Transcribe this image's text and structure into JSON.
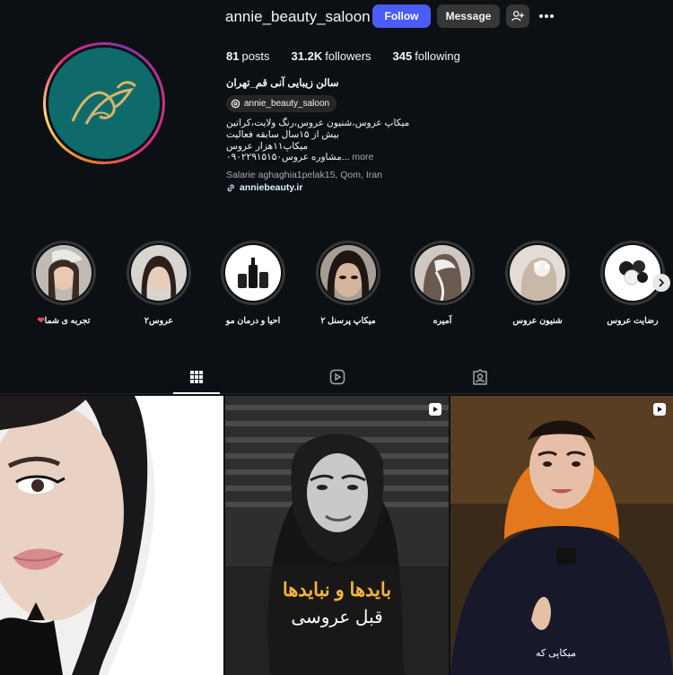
{
  "profile": {
    "username": "annie_beauty_saloon",
    "follow_label": "Follow",
    "message_label": "Message",
    "full_name": "سالن زیبایی آنی قم_تهران",
    "threads_handle": "annie_beauty_saloon",
    "bio_lines": [
      "میکاپ عروس،شنیون عروس،رنگ ولایت،کراتین",
      "بیش از ۱۵سال سابقه فعالیت",
      "میکاپ۱۱هزار عروس",
      "۰۹۰۲۲۹۱۵۱۵۰مشاوره عروس"
    ],
    "more_label": "more",
    "location": "Salarie aghaghia1pelak15, Qom, Iran",
    "link": "anniebeauty.ir"
  },
  "stats": {
    "posts_count": "81",
    "posts_label": "posts",
    "followers_count": "31.2K",
    "followers_label": "followers",
    "following_count": "345",
    "following_label": "following"
  },
  "highlights": [
    {
      "label": "تجربه ی شما",
      "suffix_icon": "heart-icon"
    },
    {
      "label": "عروس۲"
    },
    {
      "label": "احیا و درمان مو"
    },
    {
      "label": "میکاپ پرسنل ۲"
    },
    {
      "label": "آمیره"
    },
    {
      "label": "شنیون عروس"
    },
    {
      "label": "رضایت عروس"
    }
  ],
  "tabs": [
    {
      "icon": "grid-icon",
      "active": true
    },
    {
      "icon": "reels-icon",
      "active": false
    },
    {
      "icon": "tagged-icon",
      "active": false
    }
  ],
  "posts": [
    {
      "type": "image"
    },
    {
      "type": "reel",
      "overlay_title": "بایدها و نبایدها",
      "overlay_subtitle": "قبل عروسی"
    },
    {
      "type": "reel",
      "caption": "میکاپی که"
    }
  ],
  "colors": {
    "background": "#0c1014",
    "follow_button": "#4a5df9",
    "secondary_button": "#363636",
    "avatar_bg": "#0f6b6b",
    "avatar_logo": "#d9b56a",
    "overlay_title": "#f2b33d",
    "heart": "#ed4956"
  }
}
